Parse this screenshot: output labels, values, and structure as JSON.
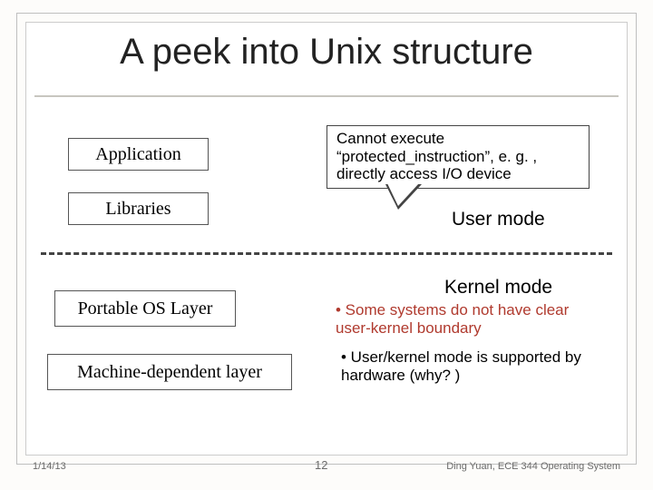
{
  "title": "A peek into Unix structure",
  "layers": {
    "application": "Application",
    "libraries": "Libraries",
    "portable_os": "Portable OS Layer",
    "machine_dependent": "Machine-dependent layer"
  },
  "callout": "Cannot execute “protected_instruction”, e. g. , directly access I/O device",
  "modes": {
    "user": "User mode",
    "kernel": "Kernel mode"
  },
  "kernel_notes": {
    "bullet1": "• Some systems do not have clear user-kernel boundary",
    "bullet2": "• User/kernel mode is supported by hardware (why? )"
  },
  "footer": {
    "date": "1/14/13",
    "page": "12",
    "credit": "Ding Yuan, ECE 344 Operating System"
  }
}
